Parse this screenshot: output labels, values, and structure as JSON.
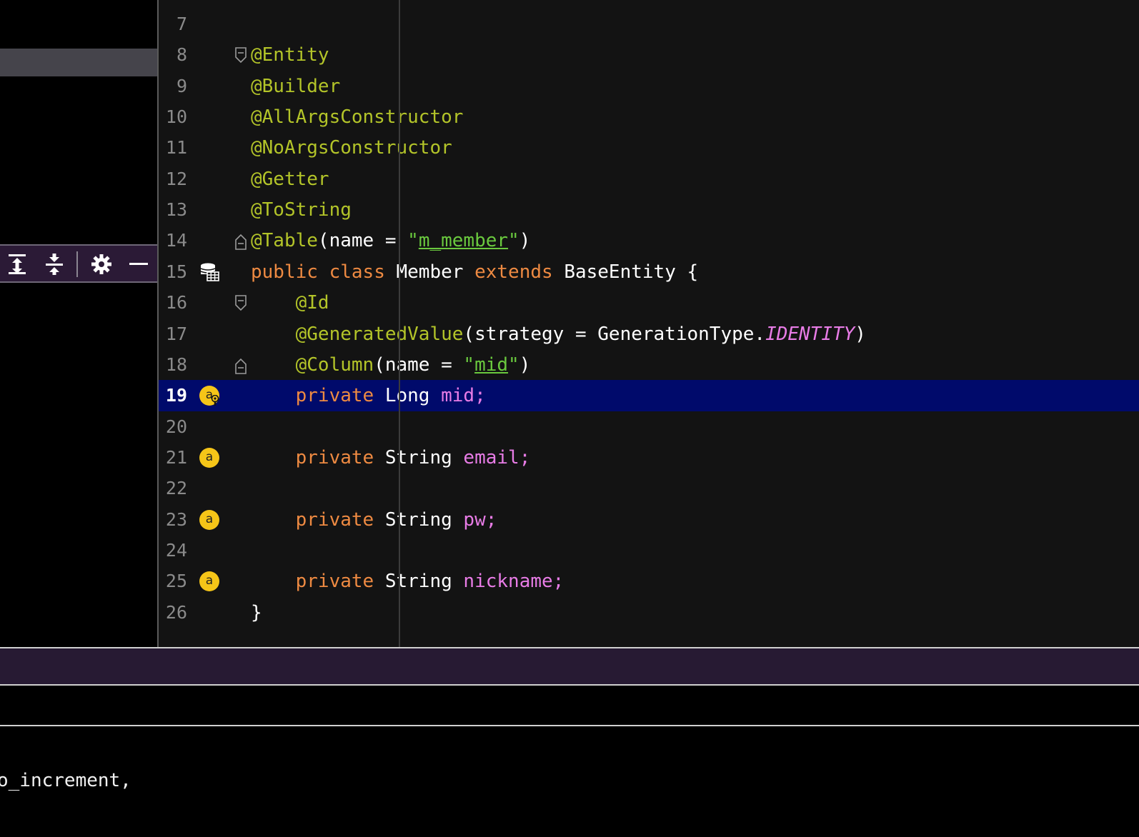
{
  "editor": {
    "lines": [
      {
        "n": "7",
        "tokens": []
      },
      {
        "n": "8",
        "fold": "open",
        "tokens": [
          {
            "t": "@Entity",
            "c": "ann"
          }
        ]
      },
      {
        "n": "9",
        "tokens": [
          {
            "t": "@Builder",
            "c": "ann"
          }
        ]
      },
      {
        "n": "10",
        "tokens": [
          {
            "t": "@AllArgsConstructor",
            "c": "ann"
          }
        ]
      },
      {
        "n": "11",
        "tokens": [
          {
            "t": "@NoArgsConstructor",
            "c": "ann"
          }
        ]
      },
      {
        "n": "12",
        "tokens": [
          {
            "t": "@Getter",
            "c": "ann"
          }
        ]
      },
      {
        "n": "13",
        "tokens": [
          {
            "t": "@ToString",
            "c": "ann"
          }
        ]
      },
      {
        "n": "14",
        "fold": "close",
        "tokens": [
          {
            "t": "@Table",
            "c": "ann"
          },
          {
            "t": "(name = ",
            "c": ""
          },
          {
            "t": "\"",
            "c": "str"
          },
          {
            "t": "m_member",
            "c": "str under"
          },
          {
            "t": "\"",
            "c": "str"
          },
          {
            "t": ")",
            "c": ""
          }
        ]
      },
      {
        "n": "15",
        "gicon": "database-table-icon",
        "tokens": [
          {
            "t": "public ",
            "c": "kw"
          },
          {
            "t": "class ",
            "c": "kw"
          },
          {
            "t": "Member ",
            "c": ""
          },
          {
            "t": "extends ",
            "c": "kw"
          },
          {
            "t": "BaseEntity {",
            "c": ""
          }
        ]
      },
      {
        "n": "16",
        "fold": "open",
        "tokens": [
          {
            "t": "    @Id",
            "c": "ann"
          }
        ]
      },
      {
        "n": "17",
        "tokens": [
          {
            "t": "    @GeneratedValue",
            "c": "ann"
          },
          {
            "t": "(strategy = GenerationType.",
            "c": ""
          },
          {
            "t": "IDENTITY",
            "c": "field italic"
          },
          {
            "t": ")",
            "c": ""
          }
        ]
      },
      {
        "n": "18",
        "fold": "close",
        "tokens": [
          {
            "t": "    @Column",
            "c": "ann"
          },
          {
            "t": "(name = ",
            "c": ""
          },
          {
            "t": "\"",
            "c": "str"
          },
          {
            "t": "mid",
            "c": "str under"
          },
          {
            "t": "\"",
            "c": "str"
          },
          {
            "t": ")",
            "c": ""
          }
        ]
      },
      {
        "n": "19",
        "current": true,
        "gicon": "attribute-key-icon",
        "tokens": [
          {
            "t": "    private ",
            "c": "kw"
          },
          {
            "t": "Long ",
            "c": ""
          },
          {
            "t": "mid;",
            "c": "field"
          }
        ]
      },
      {
        "n": "20",
        "tokens": []
      },
      {
        "n": "21",
        "gicon": "attribute-icon",
        "tokens": [
          {
            "t": "    private ",
            "c": "kw"
          },
          {
            "t": "String ",
            "c": ""
          },
          {
            "t": "email;",
            "c": "field"
          }
        ]
      },
      {
        "n": "22",
        "tokens": []
      },
      {
        "n": "23",
        "gicon": "attribute-icon",
        "tokens": [
          {
            "t": "    private ",
            "c": "kw"
          },
          {
            "t": "String ",
            "c": ""
          },
          {
            "t": "pw;",
            "c": "field"
          }
        ]
      },
      {
        "n": "24",
        "tokens": []
      },
      {
        "n": "25",
        "gicon": "attribute-icon",
        "tokens": [
          {
            "t": "    private ",
            "c": "kw"
          },
          {
            "t": "String ",
            "c": ""
          },
          {
            "t": "nickname;",
            "c": "field"
          }
        ]
      },
      {
        "n": "26",
        "tokens": [
          {
            "t": "}",
            "c": ""
          }
        ]
      }
    ],
    "badge_letter": "a"
  },
  "left_panel": {
    "toolbar": [
      {
        "name": "expand-all-icon"
      },
      {
        "name": "collapse-all-icon"
      },
      {
        "name": "gear-icon"
      },
      {
        "name": "minimize-icon"
      }
    ]
  },
  "console": {
    "line": "o_increment,"
  },
  "colors": {
    "annotation": "#b3c429",
    "keyword": "#ee8a42",
    "string": "#6ac93e",
    "field": "#e87ce6",
    "current_line": "#000a6b",
    "badge": "#f5c518"
  }
}
